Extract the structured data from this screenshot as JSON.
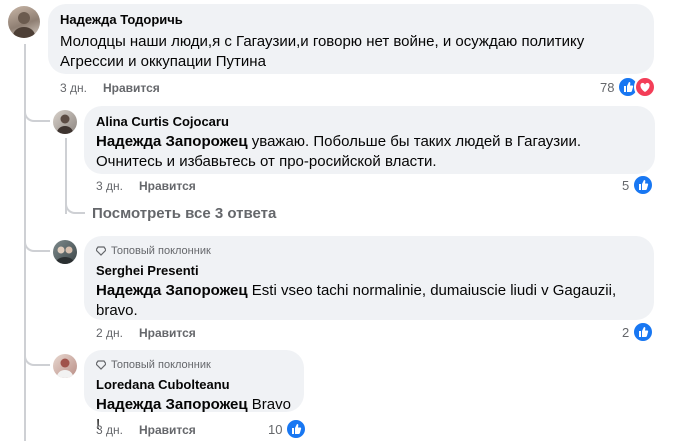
{
  "comments": [
    {
      "author": "Надежда Тодоричь",
      "text": "Молодцы наши люди,я с Гагаузии,и говорю нет войне, и осуждаю политику Агрессии и оккупации Путина",
      "line1": "Молодцы наши люди,я с Гагаузии,и говорю нет войне, и осуждаю политику",
      "line2": "Агрессии и оккупации Путина",
      "time": "3 дн.",
      "like": "Нравится",
      "reactions": "78",
      "reaction_types": [
        "like-icon",
        "love-icon"
      ]
    }
  ],
  "replies": [
    {
      "author": "Alina Curtis Cojocaru",
      "mention": "Надежда Запорожец",
      "line1": " уважаю. Побольше бы таких людей в Гагаузии.",
      "line2": "Очнитесь и избавьтесь от про-росийской власти.",
      "time": "3 дн.",
      "like": "Нравится",
      "reactions": "5"
    },
    {
      "badge": "Топовый поклонник",
      "author": "Serghei Presenti",
      "mention": "Надежда Запорожец",
      "line1": " Esti vseo tachi normalinie, dumaiuscie liudi v Gagauzii,",
      "line2": "bravo.",
      "time": "2 дн.",
      "like": "Нравится",
      "reactions": "2"
    },
    {
      "badge": "Топовый поклонник",
      "author": "Loredana Cubolteanu",
      "mention": "Надежда Запорожец",
      "line1": " Bravo !",
      "time": "3 дн.",
      "like": "Нравится",
      "reactions": "10"
    }
  ],
  "see_replies": "Посмотреть все 3 ответа",
  "colors": {
    "bubble": "#f0f2f5",
    "muted": "#65676b",
    "like_blue": "#1877f2",
    "love_red": "#f33e58",
    "thread": "#ced0d4"
  }
}
